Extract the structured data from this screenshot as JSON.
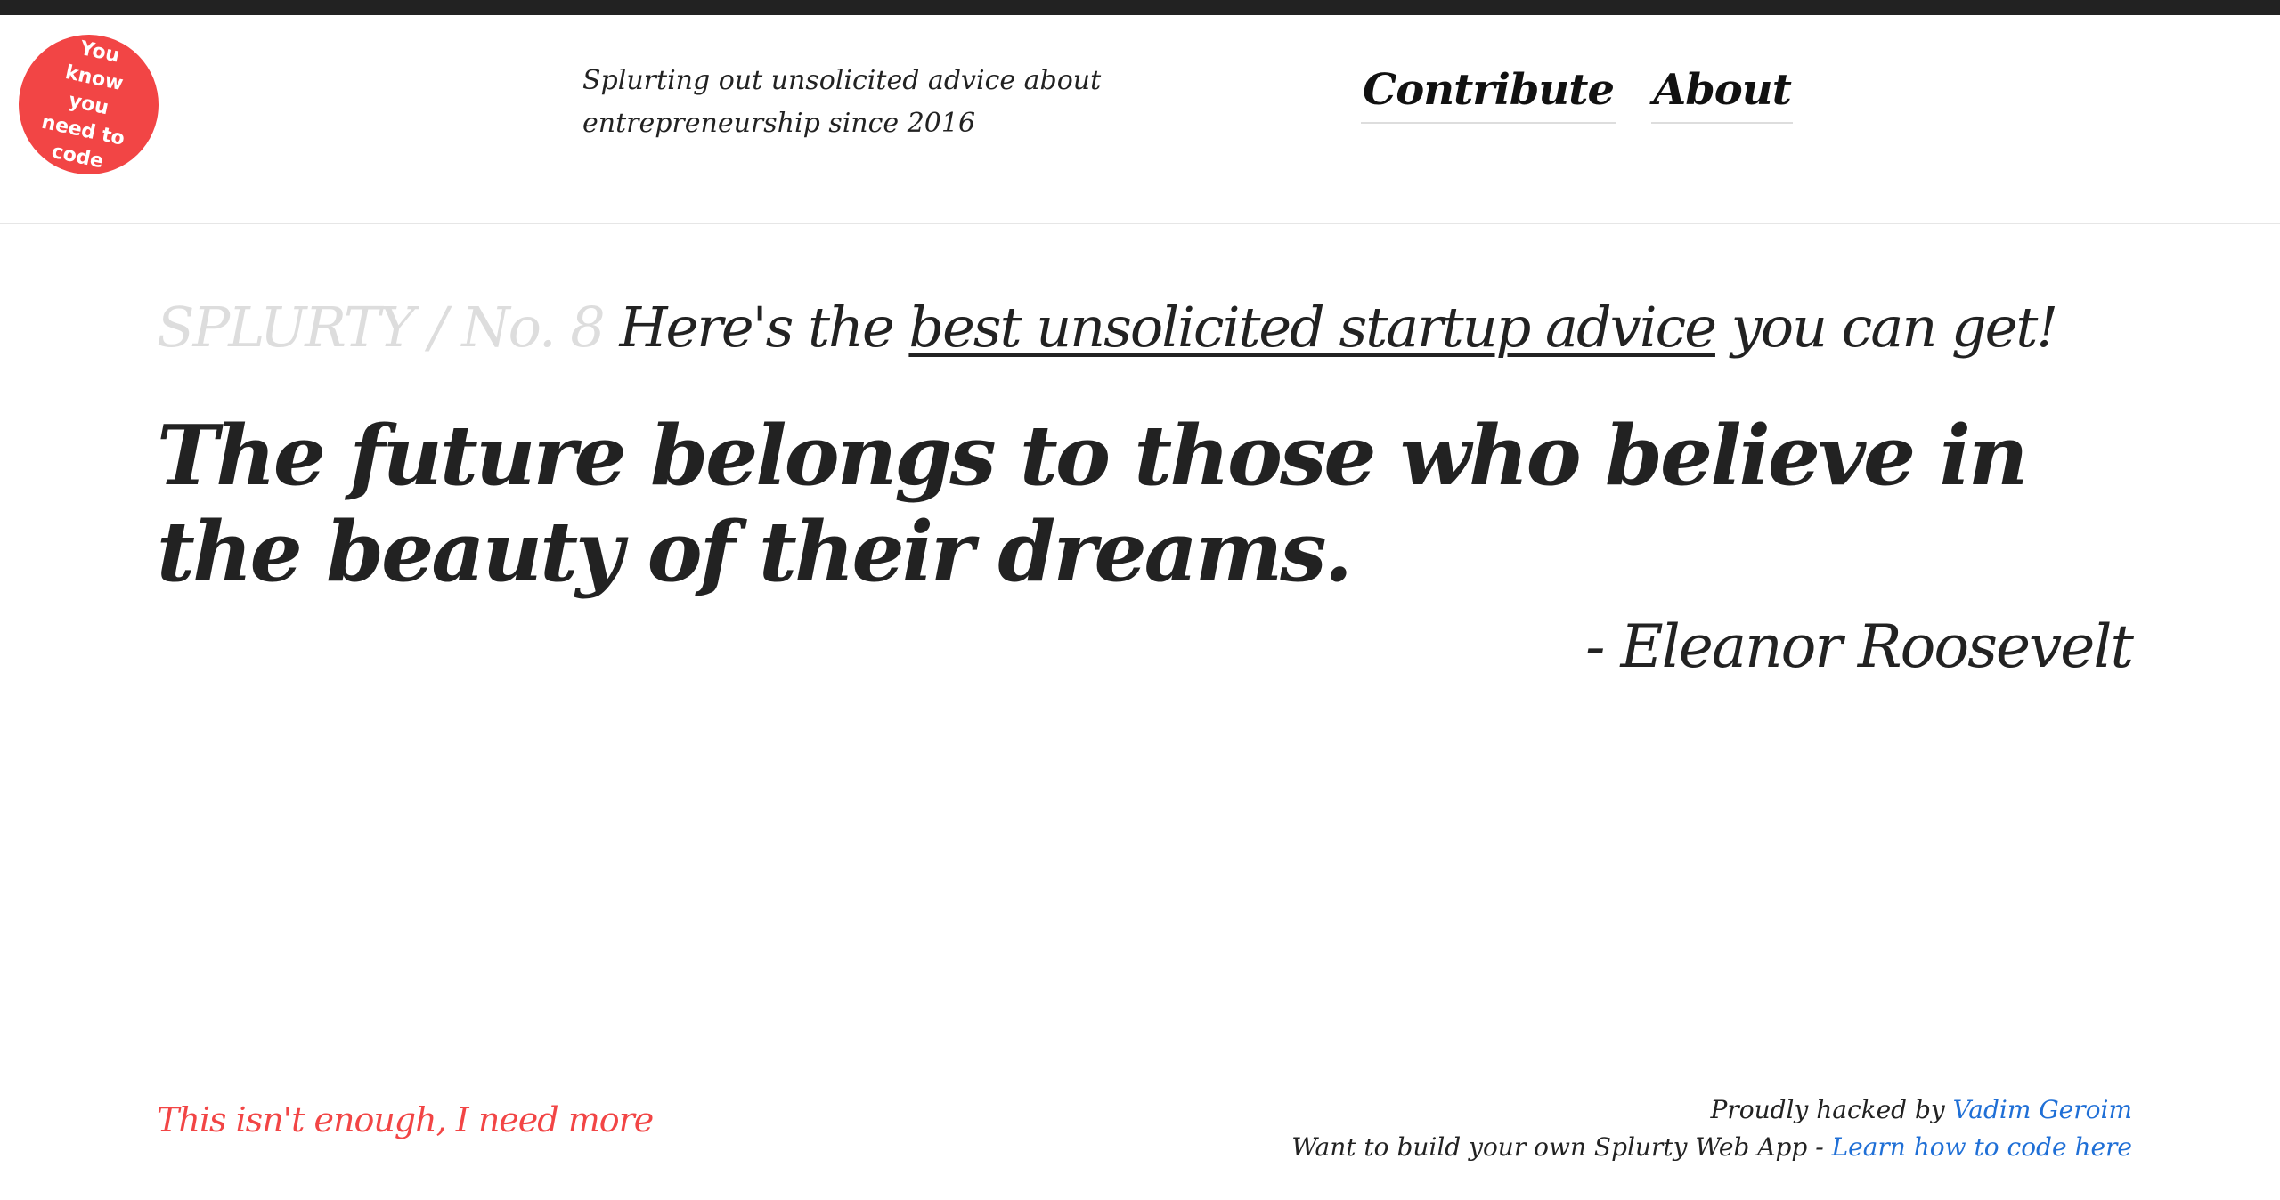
{
  "badge": {
    "text": "You know you need to code",
    "color": "#f24545"
  },
  "header": {
    "tagline": "Splurting out unsolicited advice about entrepreneurship since 2016",
    "nav": [
      {
        "label": "Contribute"
      },
      {
        "label": "About"
      }
    ]
  },
  "heading": {
    "prefix": "SPLURTY / No. 8",
    "lead": "Here's the",
    "link": "best unsolicited startup advice",
    "tail": "you can get!"
  },
  "quote": {
    "text": "The future belongs to those who believe in the beauty of their dreams.",
    "author": "- Eleanor Roosevelt"
  },
  "footer": {
    "more_link": "This isn't enough, I need more",
    "hacked_by_label": "Proudly hacked by",
    "hacked_by_name": "Vadim Geroim",
    "build_label": "Want to build your own Splurty Web App -",
    "build_link": "Learn how to code here"
  },
  "colors": {
    "accent": "#f24545",
    "link": "#1f6fd6",
    "text": "#222222",
    "muted": "#dddddd"
  }
}
